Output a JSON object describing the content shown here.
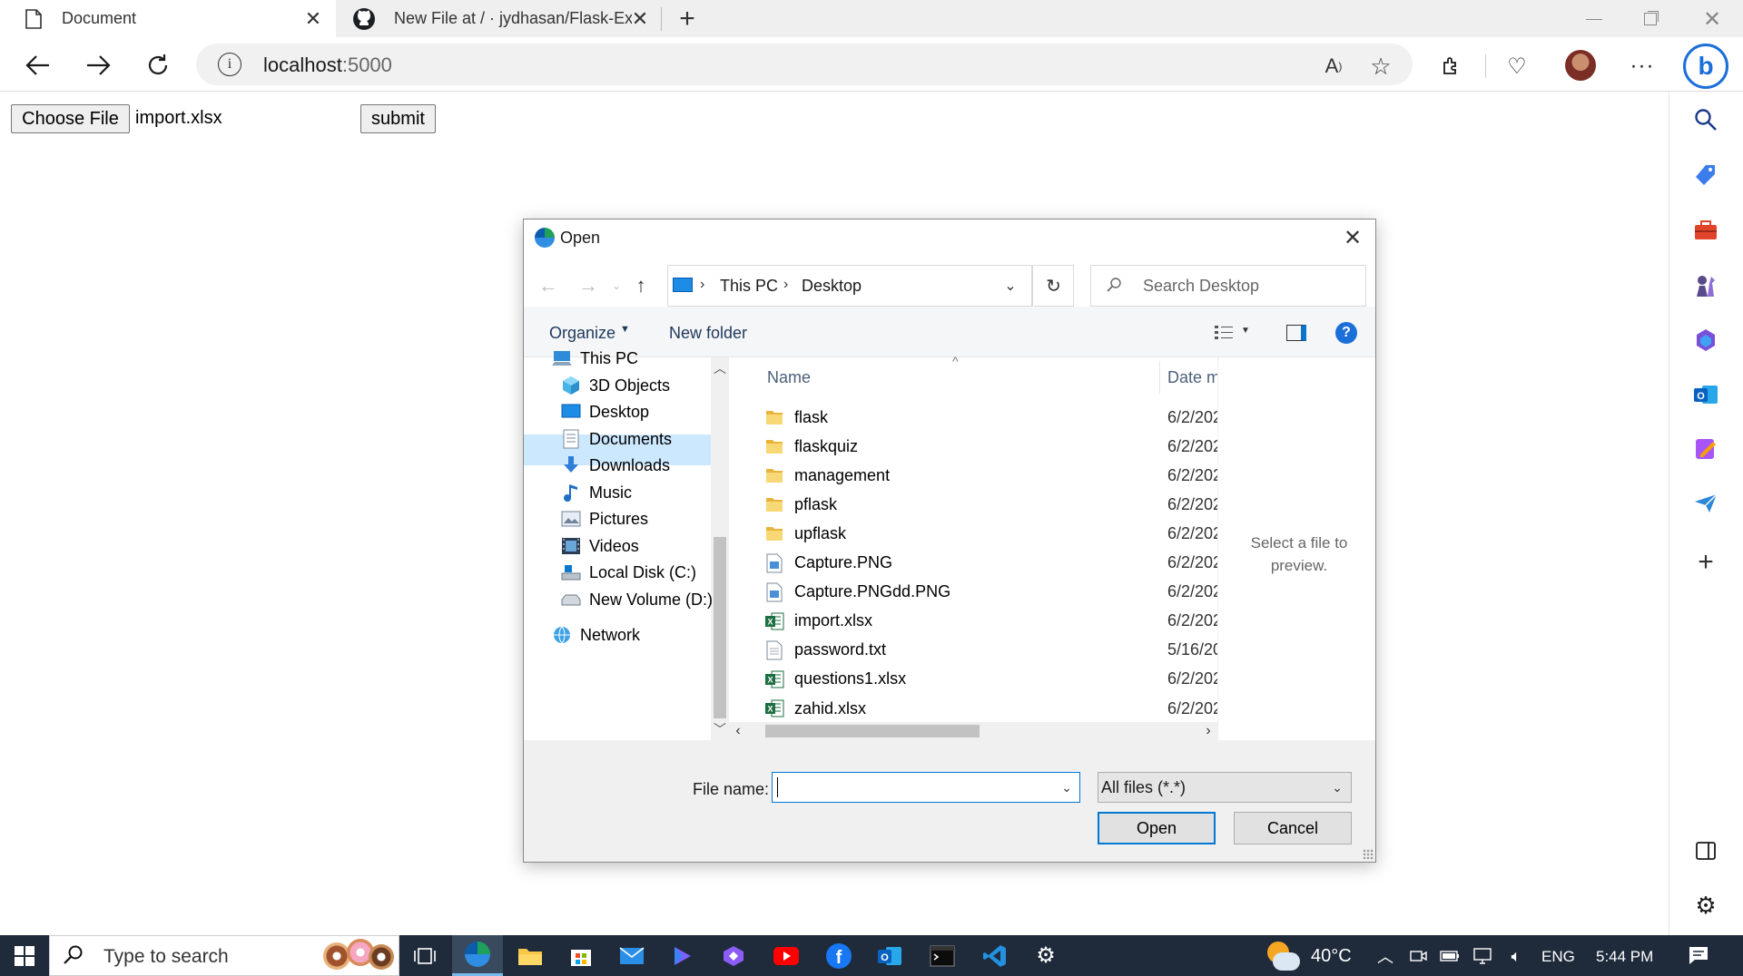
{
  "browser": {
    "tabs": [
      {
        "title": "Document",
        "active": true
      },
      {
        "title": "New File at / · jydhasan/Flask-Exc",
        "active": false
      }
    ],
    "url": {
      "host": "localhost",
      "port": ":5000"
    }
  },
  "page": {
    "choose_file_label": "Choose File",
    "chosen_file": "import.xlsx",
    "submit_label": "submit"
  },
  "dialog": {
    "title": "Open",
    "breadcrumb": [
      "This PC",
      "Desktop"
    ],
    "search_placeholder": "Search Desktop",
    "organize_label": "Organize",
    "new_folder_label": "New folder",
    "nav_items": [
      {
        "label": "This PC",
        "icon": "computer-icon"
      },
      {
        "label": "3D Objects",
        "icon": "cube-icon"
      },
      {
        "label": "Desktop",
        "icon": "desktop-icon",
        "selected": true
      },
      {
        "label": "Documents",
        "icon": "document-icon"
      },
      {
        "label": "Downloads",
        "icon": "download-icon"
      },
      {
        "label": "Music",
        "icon": "music-icon"
      },
      {
        "label": "Pictures",
        "icon": "picture-icon"
      },
      {
        "label": "Videos",
        "icon": "video-icon"
      },
      {
        "label": "Local Disk (C:)",
        "icon": "disk-icon"
      },
      {
        "label": "New Volume (D:)",
        "icon": "drive-icon"
      },
      {
        "label": "Network",
        "icon": "network-icon"
      }
    ],
    "columns": {
      "name": "Name",
      "date": "Date m"
    },
    "files": [
      {
        "name": "flask",
        "type": "folder",
        "date": "6/2/202"
      },
      {
        "name": "flaskquiz",
        "type": "folder",
        "date": "6/2/202"
      },
      {
        "name": "management",
        "type": "folder",
        "date": "6/2/202"
      },
      {
        "name": "pflask",
        "type": "folder",
        "date": "6/2/202"
      },
      {
        "name": "upflask",
        "type": "folder",
        "date": "6/2/202"
      },
      {
        "name": "Capture.PNG",
        "type": "image",
        "date": "6/2/202"
      },
      {
        "name": "Capture.PNGdd.PNG",
        "type": "image",
        "date": "6/2/202"
      },
      {
        "name": "import.xlsx",
        "type": "excel",
        "date": "6/2/202"
      },
      {
        "name": "password.txt",
        "type": "text",
        "date": "5/16/20"
      },
      {
        "name": "questions1.xlsx",
        "type": "excel",
        "date": "6/2/202"
      },
      {
        "name": "zahid.xlsx",
        "type": "excel",
        "date": "6/2/202"
      }
    ],
    "preview_text": "Select a file to preview.",
    "file_name_label": "File name:",
    "file_name_value": "",
    "filter_value": "All files (*.*)",
    "open_label": "Open",
    "cancel_label": "Cancel"
  },
  "taskbar": {
    "search_placeholder": "Type to search",
    "weather": "40°C",
    "language": "ENG",
    "time": "5:44 PM"
  },
  "colors": {
    "accent": "#0078d4",
    "taskbar": "#1f2b3b",
    "selection": "#cce8ff",
    "folder": "#f8d775",
    "excel": "#1d6f42"
  }
}
